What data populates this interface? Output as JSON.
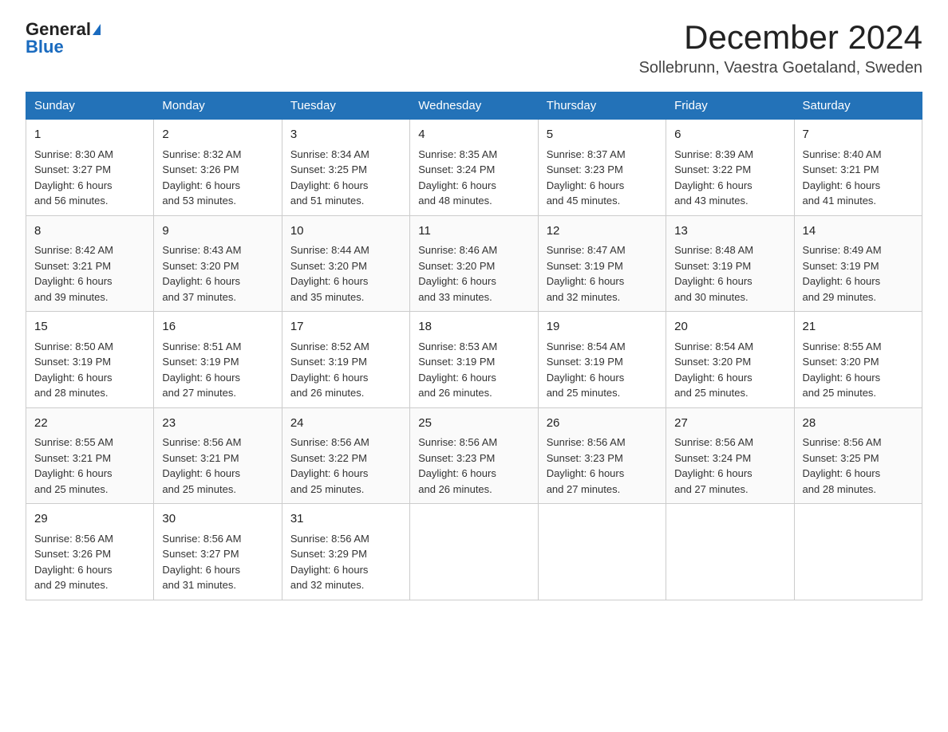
{
  "logo": {
    "general": "General",
    "blue": "Blue"
  },
  "header": {
    "title": "December 2024",
    "subtitle": "Sollebrunn, Vaestra Goetaland, Sweden"
  },
  "days_of_week": [
    "Sunday",
    "Monday",
    "Tuesday",
    "Wednesday",
    "Thursday",
    "Friday",
    "Saturday"
  ],
  "weeks": [
    [
      {
        "day": "1",
        "info": "Sunrise: 8:30 AM\nSunset: 3:27 PM\nDaylight: 6 hours\nand 56 minutes."
      },
      {
        "day": "2",
        "info": "Sunrise: 8:32 AM\nSunset: 3:26 PM\nDaylight: 6 hours\nand 53 minutes."
      },
      {
        "day": "3",
        "info": "Sunrise: 8:34 AM\nSunset: 3:25 PM\nDaylight: 6 hours\nand 51 minutes."
      },
      {
        "day": "4",
        "info": "Sunrise: 8:35 AM\nSunset: 3:24 PM\nDaylight: 6 hours\nand 48 minutes."
      },
      {
        "day": "5",
        "info": "Sunrise: 8:37 AM\nSunset: 3:23 PM\nDaylight: 6 hours\nand 45 minutes."
      },
      {
        "day": "6",
        "info": "Sunrise: 8:39 AM\nSunset: 3:22 PM\nDaylight: 6 hours\nand 43 minutes."
      },
      {
        "day": "7",
        "info": "Sunrise: 8:40 AM\nSunset: 3:21 PM\nDaylight: 6 hours\nand 41 minutes."
      }
    ],
    [
      {
        "day": "8",
        "info": "Sunrise: 8:42 AM\nSunset: 3:21 PM\nDaylight: 6 hours\nand 39 minutes."
      },
      {
        "day": "9",
        "info": "Sunrise: 8:43 AM\nSunset: 3:20 PM\nDaylight: 6 hours\nand 37 minutes."
      },
      {
        "day": "10",
        "info": "Sunrise: 8:44 AM\nSunset: 3:20 PM\nDaylight: 6 hours\nand 35 minutes."
      },
      {
        "day": "11",
        "info": "Sunrise: 8:46 AM\nSunset: 3:20 PM\nDaylight: 6 hours\nand 33 minutes."
      },
      {
        "day": "12",
        "info": "Sunrise: 8:47 AM\nSunset: 3:19 PM\nDaylight: 6 hours\nand 32 minutes."
      },
      {
        "day": "13",
        "info": "Sunrise: 8:48 AM\nSunset: 3:19 PM\nDaylight: 6 hours\nand 30 minutes."
      },
      {
        "day": "14",
        "info": "Sunrise: 8:49 AM\nSunset: 3:19 PM\nDaylight: 6 hours\nand 29 minutes."
      }
    ],
    [
      {
        "day": "15",
        "info": "Sunrise: 8:50 AM\nSunset: 3:19 PM\nDaylight: 6 hours\nand 28 minutes."
      },
      {
        "day": "16",
        "info": "Sunrise: 8:51 AM\nSunset: 3:19 PM\nDaylight: 6 hours\nand 27 minutes."
      },
      {
        "day": "17",
        "info": "Sunrise: 8:52 AM\nSunset: 3:19 PM\nDaylight: 6 hours\nand 26 minutes."
      },
      {
        "day": "18",
        "info": "Sunrise: 8:53 AM\nSunset: 3:19 PM\nDaylight: 6 hours\nand 26 minutes."
      },
      {
        "day": "19",
        "info": "Sunrise: 8:54 AM\nSunset: 3:19 PM\nDaylight: 6 hours\nand 25 minutes."
      },
      {
        "day": "20",
        "info": "Sunrise: 8:54 AM\nSunset: 3:20 PM\nDaylight: 6 hours\nand 25 minutes."
      },
      {
        "day": "21",
        "info": "Sunrise: 8:55 AM\nSunset: 3:20 PM\nDaylight: 6 hours\nand 25 minutes."
      }
    ],
    [
      {
        "day": "22",
        "info": "Sunrise: 8:55 AM\nSunset: 3:21 PM\nDaylight: 6 hours\nand 25 minutes."
      },
      {
        "day": "23",
        "info": "Sunrise: 8:56 AM\nSunset: 3:21 PM\nDaylight: 6 hours\nand 25 minutes."
      },
      {
        "day": "24",
        "info": "Sunrise: 8:56 AM\nSunset: 3:22 PM\nDaylight: 6 hours\nand 25 minutes."
      },
      {
        "day": "25",
        "info": "Sunrise: 8:56 AM\nSunset: 3:23 PM\nDaylight: 6 hours\nand 26 minutes."
      },
      {
        "day": "26",
        "info": "Sunrise: 8:56 AM\nSunset: 3:23 PM\nDaylight: 6 hours\nand 27 minutes."
      },
      {
        "day": "27",
        "info": "Sunrise: 8:56 AM\nSunset: 3:24 PM\nDaylight: 6 hours\nand 27 minutes."
      },
      {
        "day": "28",
        "info": "Sunrise: 8:56 AM\nSunset: 3:25 PM\nDaylight: 6 hours\nand 28 minutes."
      }
    ],
    [
      {
        "day": "29",
        "info": "Sunrise: 8:56 AM\nSunset: 3:26 PM\nDaylight: 6 hours\nand 29 minutes."
      },
      {
        "day": "30",
        "info": "Sunrise: 8:56 AM\nSunset: 3:27 PM\nDaylight: 6 hours\nand 31 minutes."
      },
      {
        "day": "31",
        "info": "Sunrise: 8:56 AM\nSunset: 3:29 PM\nDaylight: 6 hours\nand 32 minutes."
      },
      {
        "day": "",
        "info": ""
      },
      {
        "day": "",
        "info": ""
      },
      {
        "day": "",
        "info": ""
      },
      {
        "day": "",
        "info": ""
      }
    ]
  ]
}
